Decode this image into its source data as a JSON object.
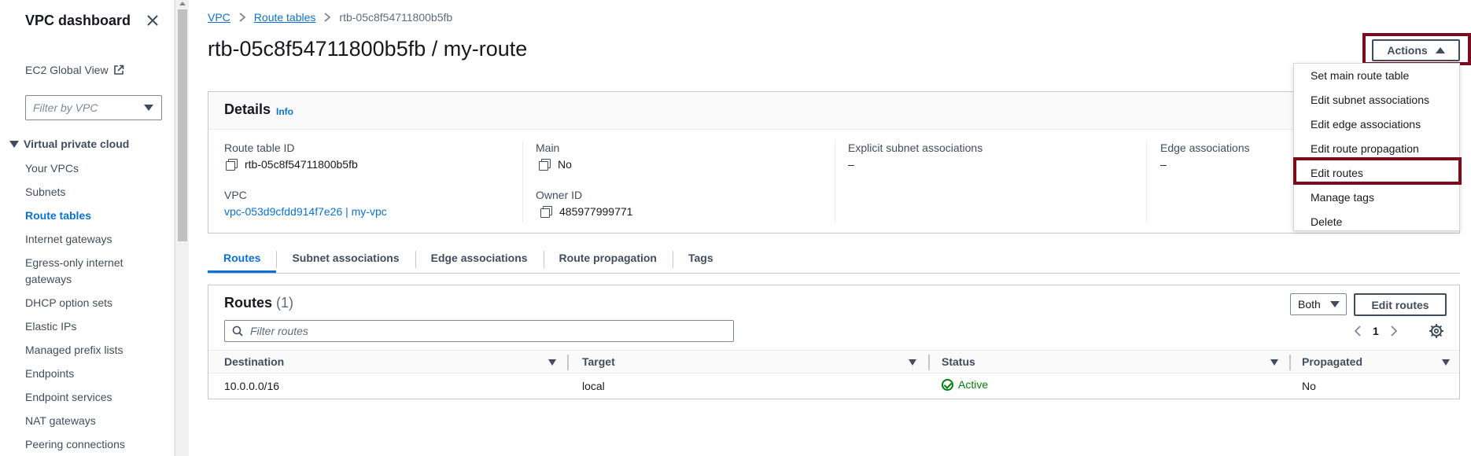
{
  "sidebar": {
    "title": "VPC dashboard",
    "ec2_global_view": "EC2 Global View",
    "filter_placeholder": "Filter by VPC",
    "section_title": "Virtual private cloud",
    "items": [
      {
        "label": "Your VPCs"
      },
      {
        "label": "Subnets"
      },
      {
        "label": "Route tables"
      },
      {
        "label": "Internet gateways"
      },
      {
        "label": "Egress-only internet gateways"
      },
      {
        "label": "DHCP option sets"
      },
      {
        "label": "Elastic IPs"
      },
      {
        "label": "Managed prefix lists"
      },
      {
        "label": "Endpoints"
      },
      {
        "label": "Endpoint services"
      },
      {
        "label": "NAT gateways"
      },
      {
        "label": "Peering connections"
      }
    ],
    "active_item": "Route tables"
  },
  "breadcrumb": {
    "vpc": "VPC",
    "route_tables": "Route tables",
    "current": "rtb-05c8f54711800b5fb"
  },
  "page_title": "rtb-05c8f54711800b5fb / my-route",
  "actions": {
    "label": "Actions",
    "menu": [
      "Set main route table",
      "Edit subnet associations",
      "Edit edge associations",
      "Edit route propagation",
      "Edit routes",
      "Manage tags",
      "Delete"
    ]
  },
  "details": {
    "title": "Details",
    "info": "Info",
    "route_table_id_label": "Route table ID",
    "route_table_id": "rtb-05c8f54711800b5fb",
    "main_label": "Main",
    "main_value": "No",
    "explicit_label": "Explicit subnet associations",
    "explicit_value": "–",
    "edge_label": "Edge associations",
    "edge_value": "–",
    "vpc_label": "VPC",
    "vpc_value": "vpc-053d9cfdd914f7e26 | my-vpc",
    "owner_label": "Owner ID",
    "owner_value": "485977999771"
  },
  "tabs": [
    "Routes",
    "Subnet associations",
    "Edge associations",
    "Route propagation",
    "Tags"
  ],
  "routes": {
    "title": "Routes",
    "count": "(1)",
    "both_label": "Both",
    "edit_routes_label": "Edit routes",
    "filter_placeholder": "Filter routes",
    "page": "1",
    "columns": [
      "Destination",
      "Target",
      "Status",
      "Propagated"
    ],
    "rows": [
      {
        "destination": "10.0.0.0/16",
        "target": "local",
        "status": "Active",
        "propagated": "No"
      }
    ]
  },
  "colors": {
    "link": "#0972d3",
    "highlight": "#7a0c1e",
    "success": "#037f0c"
  }
}
